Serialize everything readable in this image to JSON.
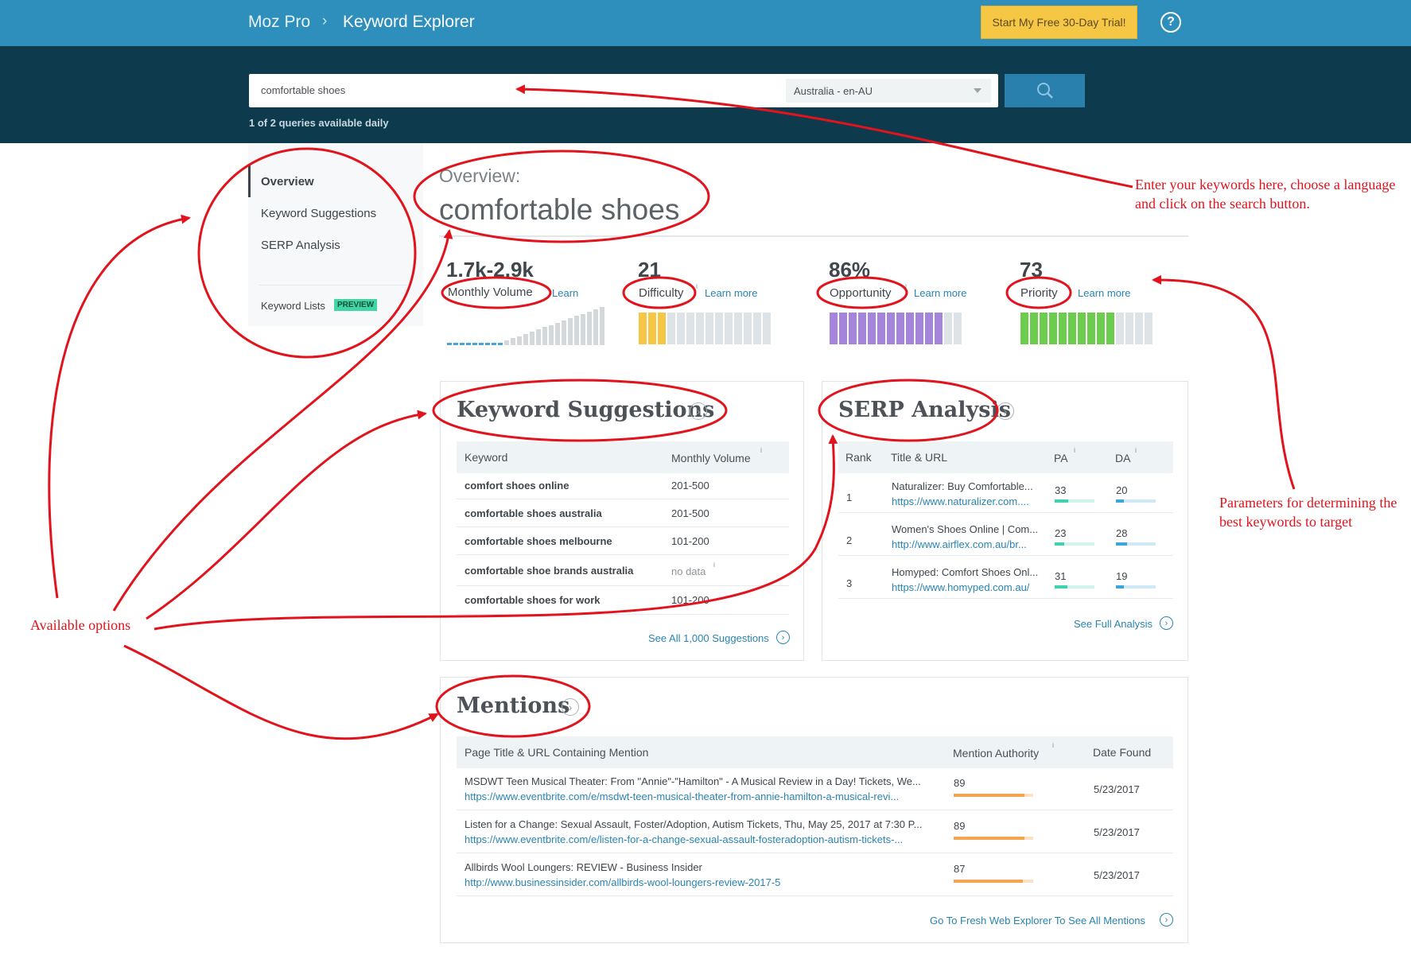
{
  "header": {
    "brand": "Moz Pro",
    "crumb_separator": "›",
    "page": "Keyword Explorer",
    "trial_button": "Start My Free 30-Day Trial!",
    "help_icon": "?"
  },
  "search": {
    "query": "comfortable shoes",
    "locale": "Australia - en-AU",
    "queries_note": "1 of 2 queries available daily"
  },
  "sidebar": {
    "items": [
      {
        "label": "Overview",
        "active": true
      },
      {
        "label": "Keyword Suggestions",
        "active": false
      },
      {
        "label": "SERP Analysis",
        "active": false
      }
    ],
    "keyword_lists": "Keyword Lists",
    "preview_badge": "PREVIEW"
  },
  "overview": {
    "label": "Overview:",
    "keyword": "comfortable shoes"
  },
  "metrics": {
    "volume": {
      "value": "1.7k-2.9k",
      "label": "Monthly Volume",
      "learn": "Learn"
    },
    "difficulty": {
      "value": "21",
      "label": "Difficulty",
      "learn": "Learn more",
      "filled": 3,
      "total": 14,
      "color": "#f6c744"
    },
    "opportunity": {
      "value": "86%",
      "label": "Opportunity",
      "learn": "Learn more",
      "filled": 12,
      "total": 14,
      "color": "#a585dc"
    },
    "priority": {
      "value": "73",
      "label": "Priority",
      "learn": "Learn more",
      "filled": 10,
      "total": 14,
      "color": "#6ccc4e"
    },
    "info_mark": "i"
  },
  "keyword_suggestions": {
    "title": "Keyword Suggestions",
    "columns": [
      "Keyword",
      "Monthly Volume"
    ],
    "rows": [
      {
        "keyword": "comfort shoes online",
        "volume": "201-500"
      },
      {
        "keyword": "comfortable shoes australia",
        "volume": "201-500"
      },
      {
        "keyword": "comfortable shoes melbourne",
        "volume": "101-200"
      },
      {
        "keyword": "comfortable shoe brands australia",
        "volume": "no data"
      },
      {
        "keyword": "comfortable shoes for work",
        "volume": "101-200"
      }
    ],
    "see_all": "See All 1,000 Suggestions"
  },
  "serp_analysis": {
    "title": "SERP Analysis",
    "columns": [
      "Rank",
      "Title & URL",
      "PA",
      "DA"
    ],
    "rows": [
      {
        "rank": "1",
        "title": "Naturalizer: Buy Comfortable...",
        "url": "https://www.naturalizer.com....",
        "pa": "33",
        "da": "20"
      },
      {
        "rank": "2",
        "title": "Women's Shoes Online | Com...",
        "url": "http://www.airflex.com.au/br...",
        "pa": "23",
        "da": "28"
      },
      {
        "rank": "3",
        "title": "Homyped: Comfort Shoes Onl...",
        "url": "https://www.homyped.com.au/",
        "pa": "31",
        "da": "19"
      }
    ],
    "see_full": "See Full Analysis"
  },
  "mentions": {
    "title": "Mentions",
    "columns": [
      "Page Title & URL Containing Mention",
      "Mention Authority",
      "Date Found"
    ],
    "rows": [
      {
        "title": "MSDWT Teen Musical Theater: From \"Annie\"-\"Hamilton\" - A Musical Review in a Day! Tickets, We...",
        "url": "https://www.eventbrite.com/e/msdwt-teen-musical-theater-from-annie-hamilton-a-musical-revi...",
        "authority": "89",
        "date": "5/23/2017"
      },
      {
        "title": "Listen for a Change: Sexual Assault, Foster/Adoption, Autism Tickets, Thu, May 25, 2017 at 7:30 P...",
        "url": "https://www.eventbrite.com/e/listen-for-a-change-sexual-assault-fosteradoption-autism-tickets-...",
        "authority": "89",
        "date": "5/23/2017"
      },
      {
        "title": "Allbirds Wool Loungers: REVIEW - Business Insider",
        "url": "http://www.businessinsider.com/allbirds-wool-loungers-review-2017-5",
        "authority": "87",
        "date": "5/23/2017"
      }
    ],
    "go_to": "Go To Fresh Web Explorer To See All Mentions"
  },
  "annotations": {
    "search_note": "Enter your keywords here, choose a language and click on the search button.",
    "options_note": "Available options",
    "params_note": "Parameters for determining the best keywords to target",
    "color": "#e1141d"
  }
}
